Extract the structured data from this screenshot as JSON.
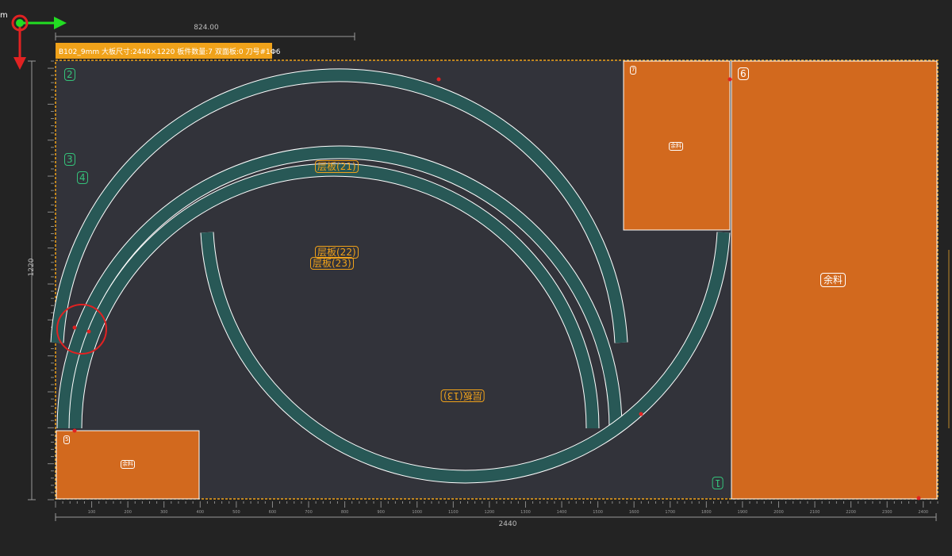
{
  "axis": {
    "origin_label": "m"
  },
  "header": {
    "info": "B102_9mm 大板尺寸:2440×1220 板件数量:7 双面板:0 刀号#1Φ6"
  },
  "dimensions": {
    "top": "824.00",
    "bottom": "2440",
    "left": "1220"
  },
  "ruler": {
    "bottom_ticks": [
      "100",
      "200",
      "300",
      "400",
      "500",
      "600",
      "700",
      "800",
      "900",
      "1000",
      "1100",
      "1200",
      "1300",
      "1400",
      "1500",
      "1600",
      "1700",
      "1800",
      "1900",
      "2000",
      "2100",
      "2200",
      "2300",
      "2400"
    ]
  },
  "parts": {
    "label_21": "层板(21)",
    "label_22": "层板(22)",
    "label_23": "层板(23)",
    "label_13": "层板(13)"
  },
  "waste": {
    "label_small": "余料",
    "label_big": "余料"
  },
  "part_numbers": {
    "n2": "2",
    "n3": "3",
    "n4": "4",
    "n1": "1",
    "n6": "6",
    "n7": "7",
    "n5": "5"
  },
  "colors": {
    "background": "#232323",
    "board": "#32333a",
    "part_fill": "#285856",
    "waste_fill": "#d2691e",
    "accent": "#f0a21a",
    "axis_x": "#22dd22",
    "axis_y": "#e12222",
    "marker": "#e12222"
  },
  "icons": {
    "origin": "origin-axis-icon",
    "highlight": "highlight-circle-icon"
  }
}
